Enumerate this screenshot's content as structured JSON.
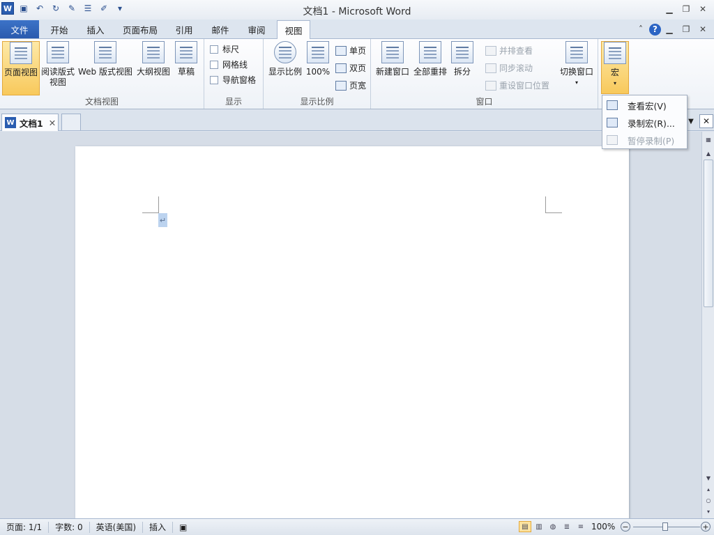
{
  "app": {
    "title": "文档1  -  Microsoft Word",
    "logo": "W",
    "accent_color": "#2a5aae",
    "highlight_color": "#f8c95c"
  },
  "qat": {
    "icons": [
      "save-icon",
      "undo-icon",
      "redo-icon",
      "new-document-icon",
      "bullets-icon",
      "format-painter-icon",
      "customize-qat-icon"
    ]
  },
  "tabs": {
    "file": "文件",
    "home": "开始",
    "insert": "插入",
    "page_layout": "页面布局",
    "references": "引用",
    "mailings": "邮件",
    "review": "审阅",
    "view": "视图",
    "active": "view"
  },
  "ribbon": {
    "document_views": {
      "label": "文档视图",
      "print_layout": "页面视图",
      "reading_line1": "阅读版式",
      "reading_line2": "视图",
      "web_layout": "Web 版式视图",
      "outline": "大纲视图",
      "draft": "草稿"
    },
    "show": {
      "label": "显示",
      "ruler": "标尺",
      "gridlines": "网格线",
      "navigation_pane": "导航窗格"
    },
    "zoom": {
      "label": "显示比例",
      "zoom": "显示比例",
      "hundred": "100%",
      "one_page": "单页",
      "two_pages": "双页",
      "page_width": "页宽"
    },
    "window": {
      "label": "窗口",
      "new_window": "新建窗口",
      "arrange_all": "全部重排",
      "split": "拆分",
      "side_by_side": "并排查看",
      "sync_scroll": "同步滚动",
      "reset_position": "重设窗口位置",
      "switch_windows": "切换窗口"
    },
    "macros": {
      "label": "宏"
    }
  },
  "macro_menu": {
    "view_macros": "查看宏(V)",
    "record_macro": "录制宏(R)...",
    "pause_recording": "暂停录制(P)"
  },
  "doc_tab": {
    "name": "文档1",
    "close": "✕"
  },
  "status": {
    "page": "页面: 1/1",
    "words": "字数: 0",
    "language": "英语(美国)",
    "mode": "插入",
    "zoom": "100%"
  }
}
